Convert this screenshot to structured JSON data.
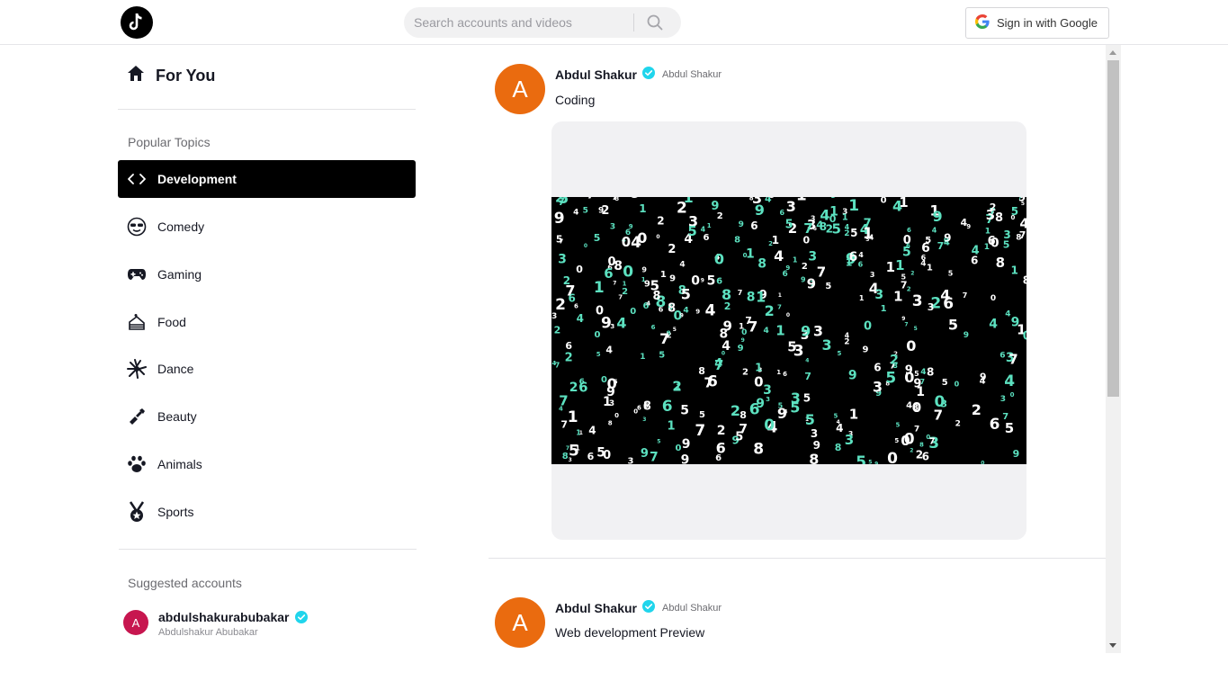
{
  "header": {
    "search_placeholder": "Search accounts and videos",
    "google_label": "Sign in with Google",
    "logo_icon": "tiktok-logo-icon"
  },
  "sidebar": {
    "for_you": "For You",
    "popular_topics_title": "Popular Topics",
    "topics": [
      {
        "label": "Development",
        "icon": "code-icon",
        "active": true
      },
      {
        "label": "Comedy",
        "icon": "sunglasses-face-icon"
      },
      {
        "label": "Gaming",
        "icon": "gamepad-icon"
      },
      {
        "label": "Food",
        "icon": "cake-icon"
      },
      {
        "label": "Dance",
        "icon": "dancer-icon"
      },
      {
        "label": "Beauty",
        "icon": "lipstick-icon"
      },
      {
        "label": "Animals",
        "icon": "paw-icon"
      },
      {
        "label": "Sports",
        "icon": "medal-icon"
      }
    ],
    "suggested_title": "Suggested accounts",
    "suggested": [
      {
        "avatar_letter": "A",
        "username": "abdulshakurabubakar",
        "display_name": "Abdulshakur Abubakar"
      }
    ]
  },
  "feed": {
    "posts": [
      {
        "avatar_letter": "A",
        "author": "Abdul Shakur",
        "nickname": "Abdul Shakur",
        "caption": "Coding"
      },
      {
        "avatar_letter": "A",
        "author": "Abdul Shakur",
        "nickname": "Abdul Shakur",
        "caption": "Web development Preview"
      }
    ]
  },
  "colors": {
    "accent_active": "#000000",
    "avatar_orange": "#ea6b0f",
    "avatar_pink": "#c7164f",
    "verified_blue": "#20d5ec",
    "matrix_green": "#5ce1c0"
  }
}
